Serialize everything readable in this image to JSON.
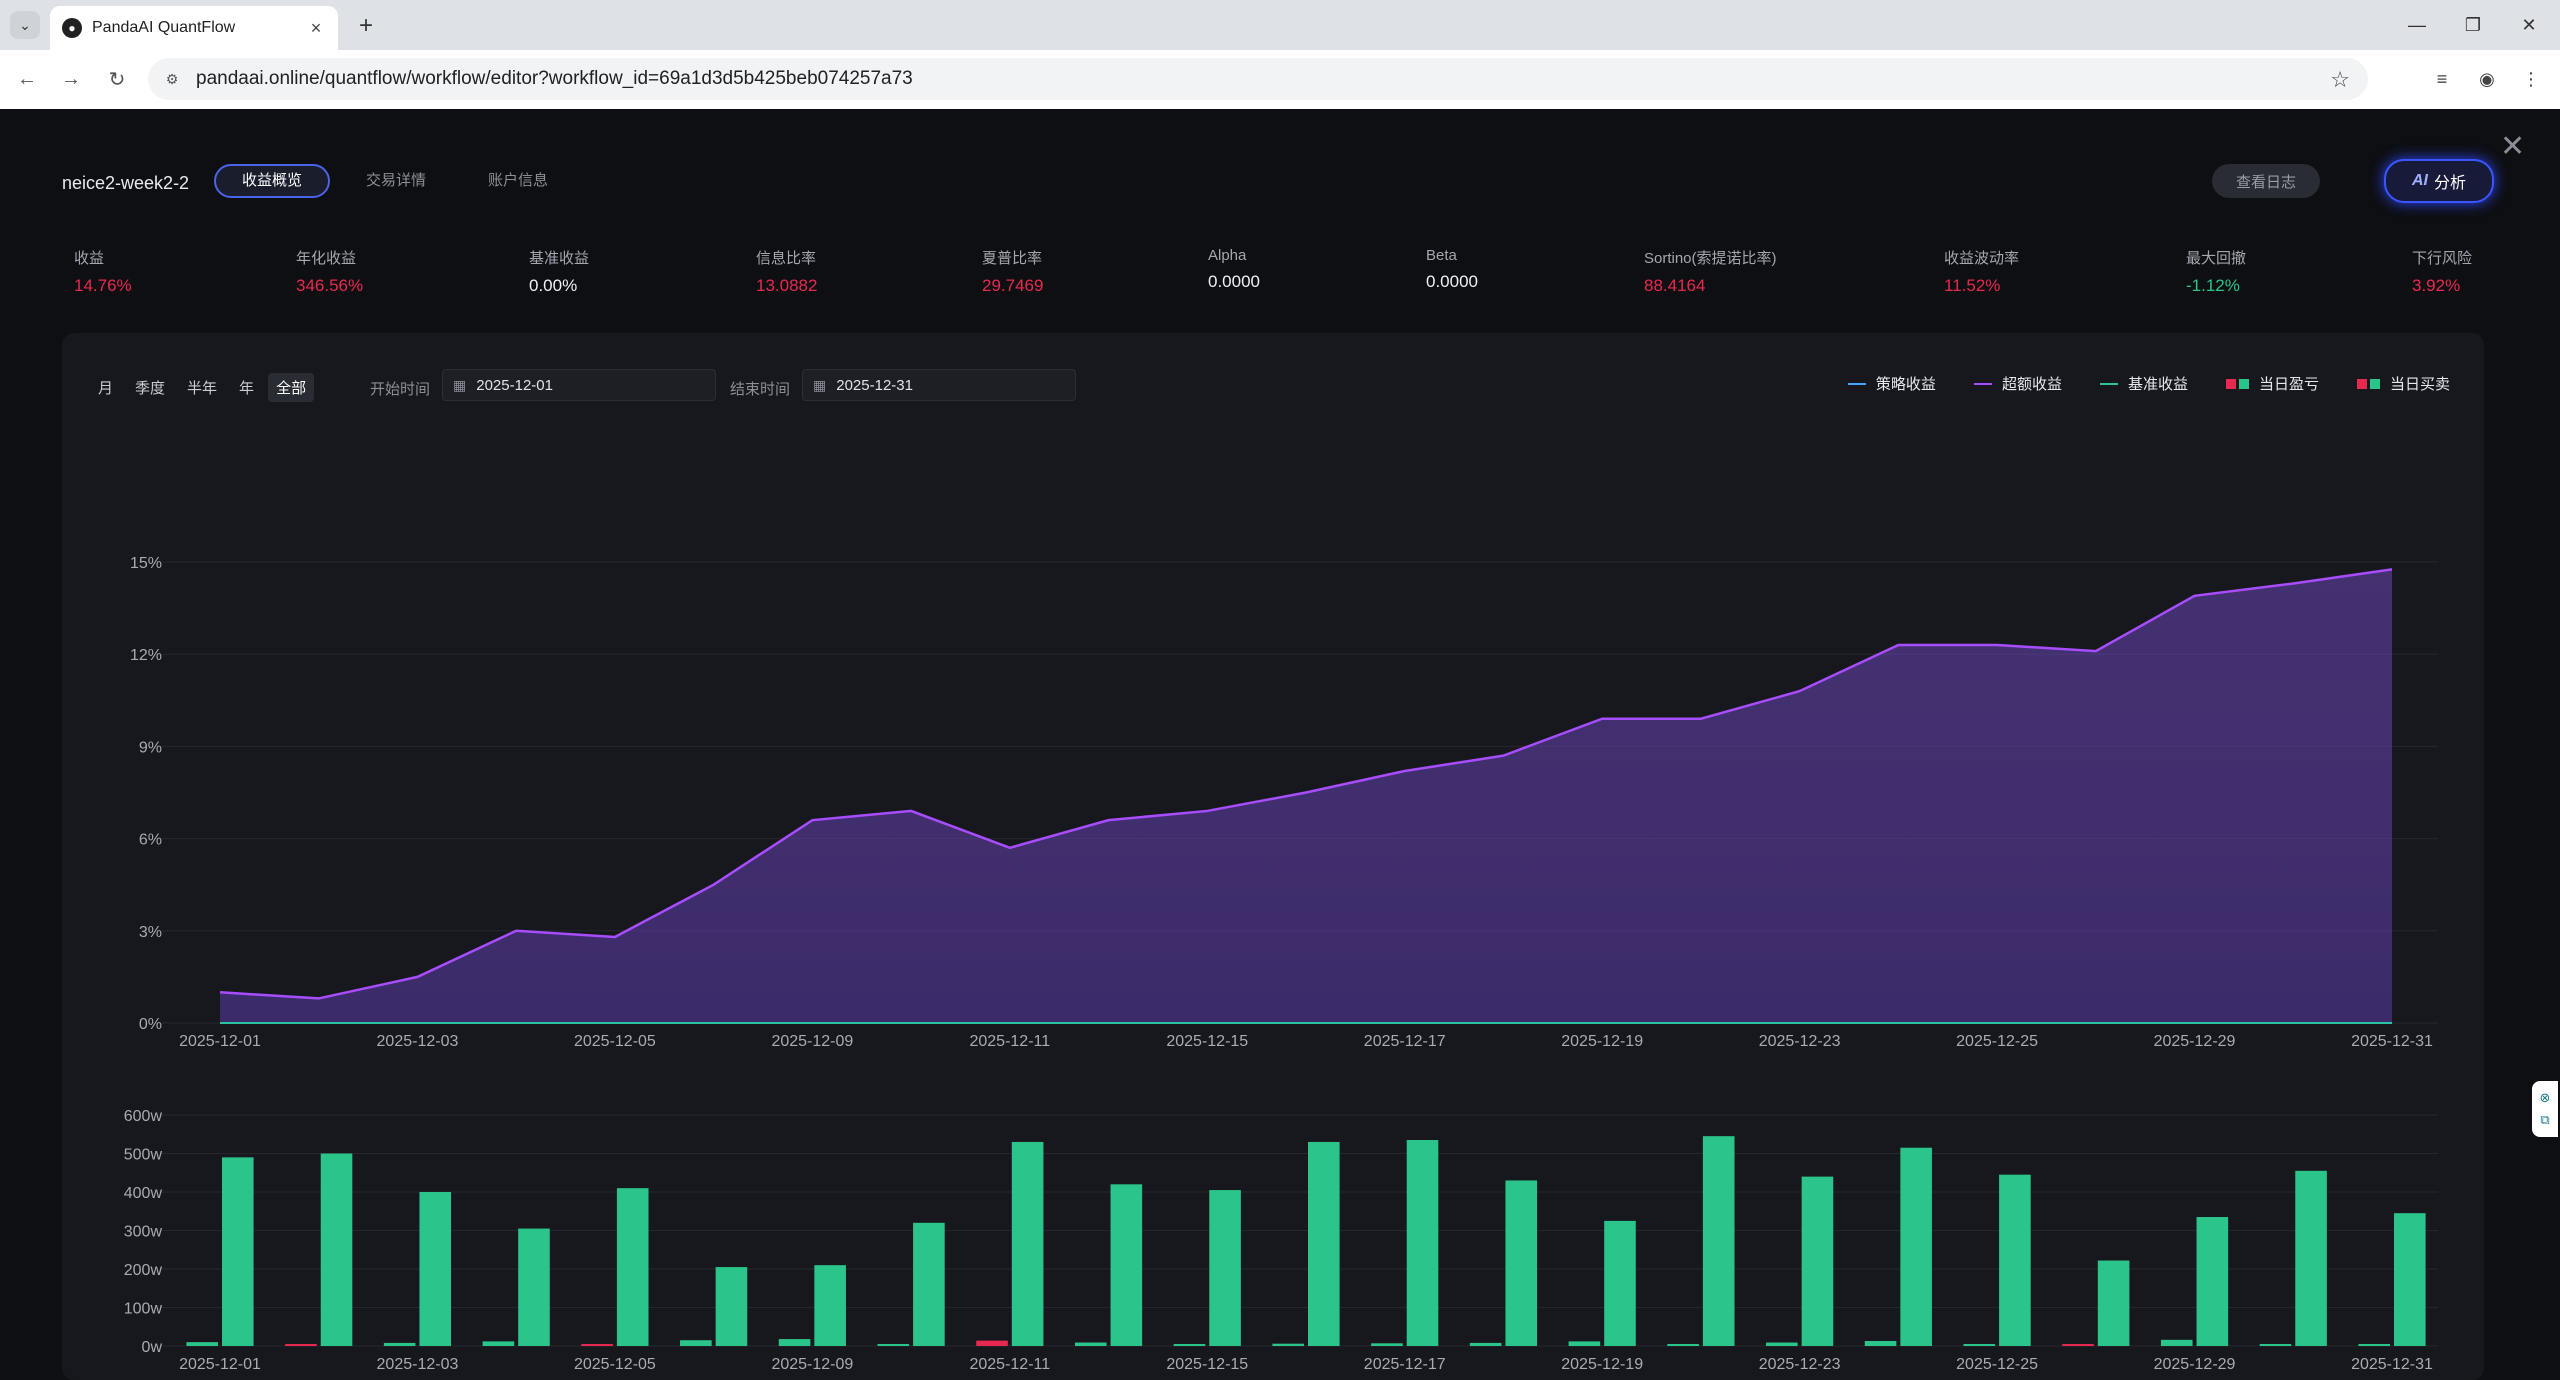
{
  "browser": {
    "tab_title": "PandaAI QuantFlow",
    "url": "pandaai.online/quantflow/workflow/editor?workflow_id=69a1d3d5b425beb074257a73"
  },
  "header": {
    "title": "neice2-week2-2",
    "tabs": [
      {
        "label": "收益概览",
        "active": true
      },
      {
        "label": "交易详情",
        "active": false
      },
      {
        "label": "账户信息",
        "active": false
      }
    ],
    "log_button": "查看日志",
    "ai_icon": "AI",
    "ai_button": "分析"
  },
  "metrics": [
    {
      "label": "收益",
      "value": "14.76%",
      "color": "#e8294f"
    },
    {
      "label": "年化收益",
      "value": "346.56%",
      "color": "#e8294f"
    },
    {
      "label": "基准收益",
      "value": "0.00%",
      "color": "#f0f1f5"
    },
    {
      "label": "信息比率",
      "value": "13.0882",
      "color": "#e8294f"
    },
    {
      "label": "夏普比率",
      "value": "29.7469",
      "color": "#e8294f"
    },
    {
      "label": "Alpha",
      "value": "0.0000",
      "color": "#f0f1f5"
    },
    {
      "label": "Beta",
      "value": "0.0000",
      "color": "#f0f1f5"
    },
    {
      "label": "Sortino(索提诺比率)",
      "value": "88.4164",
      "color": "#e8294f"
    },
    {
      "label": "收益波动率",
      "value": "11.52%",
      "color": "#e8294f"
    },
    {
      "label": "最大回撤",
      "value": "-1.12%",
      "color": "#2bc48a"
    },
    {
      "label": "下行风险",
      "value": "3.92%",
      "color": "#e8294f"
    }
  ],
  "filters": {
    "periods": [
      "月",
      "季度",
      "半年",
      "年",
      "全部"
    ],
    "active_period": "全部",
    "start_label": "开始时间",
    "start_date": "2025-12-01",
    "end_label": "结束时间",
    "end_date": "2025-12-31"
  },
  "legend": [
    {
      "name": "策略收益",
      "type": "line",
      "color": "#4a9eff"
    },
    {
      "name": "超额收益",
      "type": "line",
      "color": "#a64dff"
    },
    {
      "name": "基准收益",
      "type": "line",
      "color": "#2bc4a0"
    },
    {
      "name": "当日盈亏",
      "type": "bar",
      "colors": [
        "#e8294f",
        "#2bc48a"
      ]
    },
    {
      "name": "当日买卖",
      "type": "bar",
      "colors": [
        "#e8294f",
        "#2bc48a"
      ]
    }
  ],
  "chart_data": [
    {
      "type": "area",
      "x_tick_labels": [
        "2025-12-01",
        "2025-12-03",
        "2025-12-05",
        "2025-12-09",
        "2025-12-11",
        "2025-12-15",
        "2025-12-17",
        "2025-12-19",
        "2025-12-23",
        "2025-12-25",
        "2025-12-29",
        "2025-12-31"
      ],
      "y_tick_labels": [
        "0%",
        "3%",
        "6%",
        "9%",
        "12%",
        "15%"
      ],
      "ylim": [
        0,
        15
      ],
      "series": [
        {
          "name": "超额收益",
          "color": "#a64dff",
          "values": [
            1.0,
            0.8,
            1.5,
            3.0,
            2.8,
            4.5,
            6.6,
            6.9,
            5.7,
            6.6,
            6.9,
            7.5,
            8.2,
            8.7,
            9.9,
            9.9,
            10.8,
            12.3,
            12.3,
            12.1,
            13.9,
            14.3,
            14.76
          ]
        },
        {
          "name": "基准收益",
          "color": "#2bc4a0",
          "values": [
            0,
            0,
            0,
            0,
            0,
            0,
            0,
            0,
            0,
            0,
            0,
            0,
            0,
            0,
            0,
            0,
            0,
            0,
            0,
            0,
            0,
            0,
            0
          ]
        }
      ]
    },
    {
      "type": "bar",
      "x_tick_labels": [
        "2025-12-01",
        "2025-12-03",
        "2025-12-05",
        "2025-12-09",
        "2025-12-11",
        "2025-12-15",
        "2025-12-17",
        "2025-12-19",
        "2025-12-23",
        "2025-12-25",
        "2025-12-29",
        "2025-12-31"
      ],
      "y_tick_labels": [
        "0w",
        "100w",
        "200w",
        "300w",
        "400w",
        "500w",
        "600w"
      ],
      "ylim": [
        0,
        600
      ],
      "series": [
        {
          "name": "当日盈亏",
          "values": [
            10,
            -3,
            8,
            12,
            -4,
            15,
            18,
            5,
            -14,
            9,
            3,
            6,
            7,
            8,
            12,
            2,
            9,
            13,
            1,
            -5,
            16,
            4,
            3
          ]
        },
        {
          "name": "当日买卖",
          "values": [
            490,
            500,
            400,
            305,
            410,
            205,
            210,
            320,
            530,
            420,
            405,
            530,
            535,
            430,
            325,
            545,
            440,
            515,
            445,
            222,
            335,
            455,
            345
          ]
        }
      ]
    }
  ]
}
